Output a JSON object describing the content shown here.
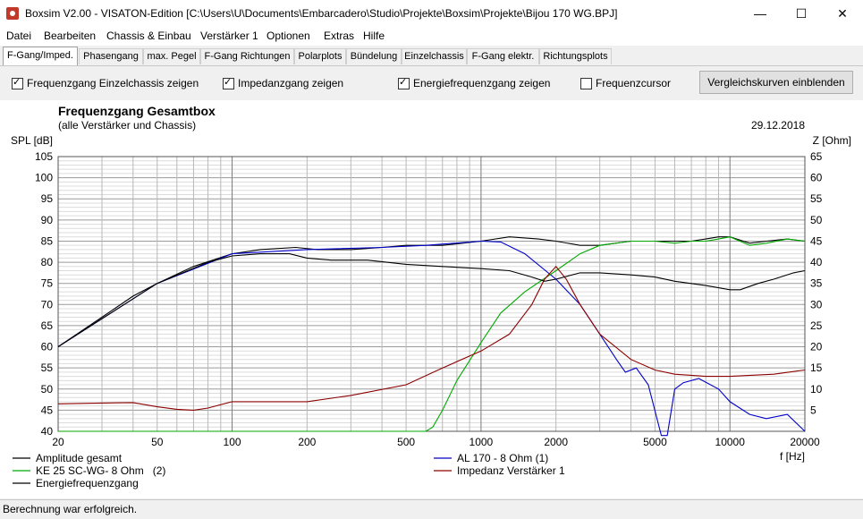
{
  "window": {
    "title": "Boxsim V2.00 - VISATON-Edition [C:\\Users\\U\\Documents\\Embarcadero\\Studio\\Projekte\\Boxsim\\Projekte\\Bijou 170 WG.BPJ]",
    "minimize": "—",
    "maximize": "☐",
    "close": "✕"
  },
  "menu": [
    "Datei",
    "Bearbeiten",
    "Chassis & Einbau",
    "Verstärker 1",
    "Optionen",
    "Extras",
    "Hilfe"
  ],
  "tabs": [
    "F-Gang/Imped.",
    "Phasengang",
    "max. Pegel",
    "F-Gang Richtungen",
    "Polarplots",
    "Bündelung",
    "Einzelchassis",
    "F-Gang elektr.",
    "Richtungsplots"
  ],
  "options": {
    "cb1": "Frequenzgang Einzelchassis zeigen",
    "cb2": "Impedanzgang zeigen",
    "cb3": "Energiefrequenzgang zeigen",
    "cb4": "Frequenzcursor",
    "button": "Vergleichskurven einblenden"
  },
  "status": "Berechnung war erfolgreich.",
  "chart_data": {
    "type": "line",
    "title": "Frequenzgang Gesamtbox",
    "subtitle": "(alle Verstärker und Chassis)",
    "date": "29.12.2018",
    "ylabel_left": "SPL [dB]",
    "ylabel_right": "Z [Ohm]",
    "xlabel": "f [Hz]",
    "xscale": "log",
    "xlim": [
      20,
      20000
    ],
    "ylim_left": [
      40,
      105
    ],
    "ylim_right": [
      0,
      65
    ],
    "x_ticks": [
      "20",
      "50",
      "100",
      "200",
      "500",
      "1000",
      "2000",
      "5000",
      "10000",
      "20000"
    ],
    "y_ticks_left": [
      "105",
      "100",
      "95",
      "90",
      "85",
      "80",
      "75",
      "70",
      "65",
      "60",
      "55",
      "50",
      "45",
      "40"
    ],
    "y_ticks_right": [
      "65",
      "60",
      "55",
      "50",
      "45",
      "40",
      "35",
      "30",
      "25",
      "20",
      "15",
      "10",
      "5"
    ],
    "series": [
      {
        "name": "Amplitude gesamt",
        "color": "#000000",
        "axis": "left",
        "x": [
          20,
          30,
          40,
          50,
          70,
          100,
          130,
          180,
          220,
          300,
          400,
          500,
          700,
          1000,
          1300,
          1700,
          2000,
          2500,
          3000,
          4000,
          5000,
          6000,
          7000,
          8000,
          9000,
          10000,
          12000,
          14000,
          17000,
          20000
        ],
        "y": [
          60,
          67,
          72,
          75,
          79,
          82,
          83,
          83.5,
          83,
          83,
          83.5,
          84,
          84,
          85,
          86,
          85.5,
          85,
          84,
          84,
          85,
          85,
          85,
          85,
          85.5,
          86,
          86,
          84.5,
          85,
          85.5,
          85
        ]
      },
      {
        "name": "AL 170 - 8 Ohm (1)",
        "color": "#0000cc",
        "axis": "left",
        "x": [
          20,
          50,
          100,
          200,
          400,
          600,
          1000,
          1200,
          1500,
          2000,
          2500,
          3000,
          3500,
          3800,
          4200,
          4700,
          5300,
          5600,
          6000,
          6500,
          7500,
          9000,
          10000,
          12000,
          14000,
          17000,
          20000
        ],
        "y": [
          60,
          75,
          82,
          83,
          83.5,
          84,
          85,
          84.8,
          82,
          76,
          70,
          63,
          57,
          54,
          55,
          51,
          39,
          39,
          50,
          51.5,
          52.5,
          50,
          47,
          44,
          43,
          44,
          40
        ]
      },
      {
        "name": "KE 25 SC-WG- 8 Ohm   (2)",
        "color": "#00aa00",
        "axis": "left",
        "x": [
          20,
          100,
          500,
          600,
          640,
          700,
          800,
          1000,
          1200,
          1500,
          2000,
          2500,
          3000,
          4000,
          5000,
          6000,
          7000,
          8000,
          9000,
          10000,
          12000,
          14000,
          17000,
          20000
        ],
        "y": [
          40,
          40,
          40,
          40,
          41,
          45,
          52,
          61,
          68,
          73,
          78,
          82,
          84,
          85,
          85,
          84.5,
          85,
          85,
          85.5,
          86,
          84,
          84.5,
          85.5,
          85
        ]
      },
      {
        "name": "Impedanz Verstärker 1",
        "color": "#8b0000",
        "axis": "right",
        "x": [
          20,
          30,
          40,
          50,
          60,
          70,
          80,
          100,
          150,
          200,
          300,
          500,
          700,
          1000,
          1300,
          1600,
          1800,
          2000,
          2200,
          2500,
          3000,
          4000,
          5000,
          6000,
          8000,
          10000,
          15000,
          20000
        ],
        "y": [
          6.5,
          6.7,
          6.8,
          5.8,
          5.2,
          5.0,
          5.5,
          7.0,
          7.0,
          7.0,
          8.5,
          11,
          15,
          19,
          23,
          30,
          36,
          39,
          36,
          30,
          23,
          17,
          14.5,
          13.5,
          13,
          13,
          13.5,
          14.5
        ]
      },
      {
        "name": "Energiefrequenzgang",
        "color": "#000000",
        "axis": "left",
        "x": [
          20,
          50,
          80,
          100,
          130,
          170,
          200,
          250,
          350,
          500,
          700,
          1000,
          1300,
          1600,
          1800,
          2000,
          2500,
          3000,
          4000,
          5000,
          6000,
          8000,
          10000,
          11000,
          13000,
          15000,
          18000,
          20000
        ],
        "y": [
          60,
          75,
          80,
          81.5,
          82,
          82,
          81,
          80.5,
          80.5,
          79.5,
          79,
          78.5,
          78,
          76.5,
          75.5,
          76,
          77.5,
          77.5,
          77,
          76.5,
          75.5,
          74.5,
          73.5,
          73.5,
          75,
          76,
          77.5,
          78
        ]
      }
    ],
    "legend": [
      "Amplitude gesamt",
      "AL 170 - 8 Ohm (1)",
      "KE 25 SC-WG- 8 Ohm   (2)",
      "Impedanz Verstärker 1",
      "Energiefrequenzgang"
    ]
  }
}
